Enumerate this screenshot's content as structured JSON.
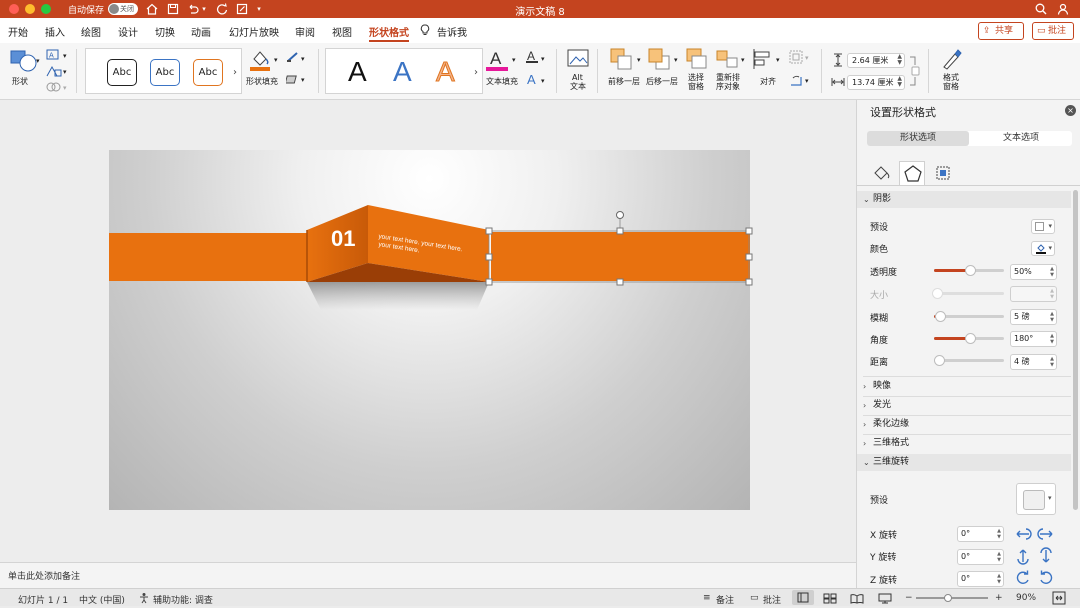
{
  "titlebar": {
    "autosave_label": "自动保存",
    "autosave_state": "关闭",
    "document_title": "演示文稿 8"
  },
  "tabs": [
    {
      "label": "开始"
    },
    {
      "label": "插入"
    },
    {
      "label": "绘图"
    },
    {
      "label": "设计"
    },
    {
      "label": "切换"
    },
    {
      "label": "动画"
    },
    {
      "label": "幻灯片放映"
    },
    {
      "label": "审阅"
    },
    {
      "label": "视图"
    },
    {
      "label": "形状格式",
      "active": true
    },
    {
      "label": "告诉我"
    }
  ],
  "share_label": "共享",
  "comment_label": "批注",
  "ribbon": {
    "shapes_label": "形状",
    "style_samples": [
      "Abc",
      "Abc",
      "Abc"
    ],
    "shape_fill_label": "形状填充",
    "wordart_samples": [
      "A",
      "A",
      "A"
    ],
    "text_fill_label": "文本填充",
    "alt_text_label_1": "Alt",
    "alt_text_label_2": "文本",
    "bring_forward_label": "前移一层",
    "send_backward_label": "后移一层",
    "selection_pane_label_1": "选择",
    "selection_pane_label_2": "窗格",
    "reorder_label_1": "重新排",
    "reorder_label_2": "序对象",
    "align_label": "对齐",
    "height_value": "2.64 厘米",
    "width_value": "13.74 厘米",
    "format_pane_label_1": "格式",
    "format_pane_label_2": "窗格",
    "accent_color": "#c4441f"
  },
  "slide": {
    "number_badge": "01",
    "body_text_1": "your text here. your text here.",
    "body_text_2": "your text here.",
    "ribbon_color": "#e8710f"
  },
  "notes_placeholder": "单击此处添加备注",
  "pane": {
    "title": "设置形状格式",
    "seg_shape": "形状选项",
    "seg_text": "文本选项",
    "sections": {
      "shadow": "阴影",
      "reflection": "映像",
      "glow": "发光",
      "soft_edges": "柔化边缘",
      "format_3d": "三维格式",
      "rotation_3d": "三维旋转"
    },
    "shadow": {
      "preset_label": "预设",
      "color_label": "颜色",
      "transparency_label": "透明度",
      "transparency_value": "50%",
      "transparency_level": 0.5,
      "size_label": "大小",
      "size_value": "",
      "blur_label": "模糊",
      "blur_value": "5 磅",
      "angle_label": "角度",
      "angle_value": "180°",
      "distance_label": "距离",
      "distance_value": "4 磅"
    },
    "rotation": {
      "preset_label": "预设",
      "x_label": "X 旋转",
      "x_value": "0°",
      "y_label": "Y 旋转",
      "y_value": "0°",
      "z_label": "Z 旋转",
      "z_value": "0°"
    }
  },
  "statusbar": {
    "slide_info": "幻灯片 1 / 1",
    "language": "中文 (中国)",
    "accessibility": "辅助功能: 调查",
    "notes_label": "备注",
    "comments_label": "批注",
    "zoom_value": "90%"
  }
}
